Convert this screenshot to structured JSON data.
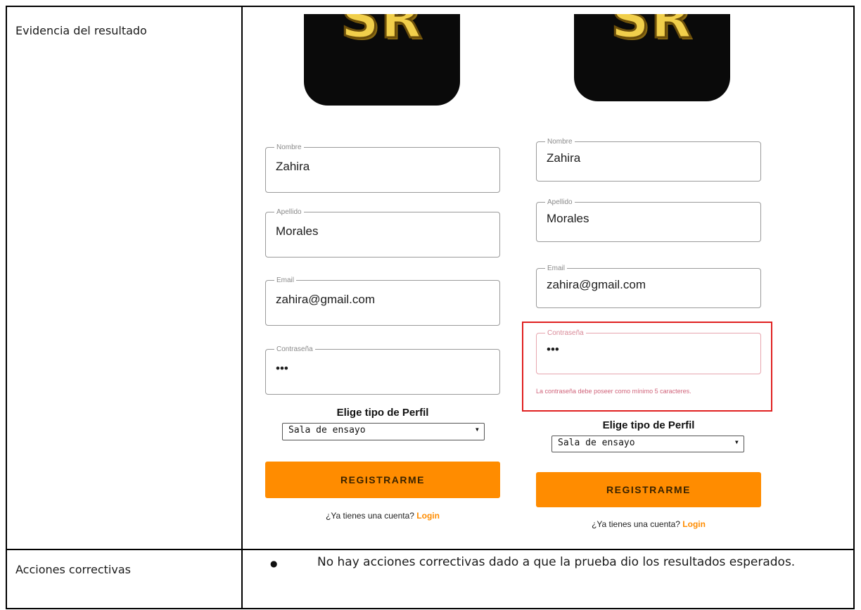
{
  "table": {
    "row1_label": "Evidencia del resultado",
    "row2_label": "Acciones correctivas",
    "actions_item": "No hay acciones correctivas dado a que la prueba dio los resultados esperados."
  },
  "logo_text": "SR",
  "left_form": {
    "nombre_label": "Nombre",
    "nombre_value": "Zahira",
    "apellido_label": "Apellido",
    "apellido_value": "Morales",
    "email_label": "Email",
    "email_value": "zahira@gmail.com",
    "password_label": "Contraseña",
    "password_value": "•••",
    "profile_label": "Elige tipo de Perfil",
    "profile_selected": "Sala de ensayo",
    "register_button": "REGISTRARME",
    "have_account": "¿Ya tienes una cuenta?",
    "login_link": "Login"
  },
  "right_form": {
    "nombre_label": "Nombre",
    "nombre_value": "Zahira",
    "apellido_label": "Apellido",
    "apellido_value": "Morales",
    "email_label": "Email",
    "email_value": "zahira@gmail.com",
    "password_label": "Contraseña",
    "password_value": "•••",
    "password_error": "La contraseña debe poseer como mínimo 5 caracteres.",
    "profile_label": "Elige tipo de Perfil",
    "profile_selected": "Sala de ensayo",
    "register_button": "REGISTRARME",
    "have_account": "¿Ya tienes una cuenta?",
    "login_link": "Login"
  },
  "colors": {
    "accent": "#ff8c00",
    "error": "#e02020",
    "logo_gold": "#f1cf4b"
  }
}
